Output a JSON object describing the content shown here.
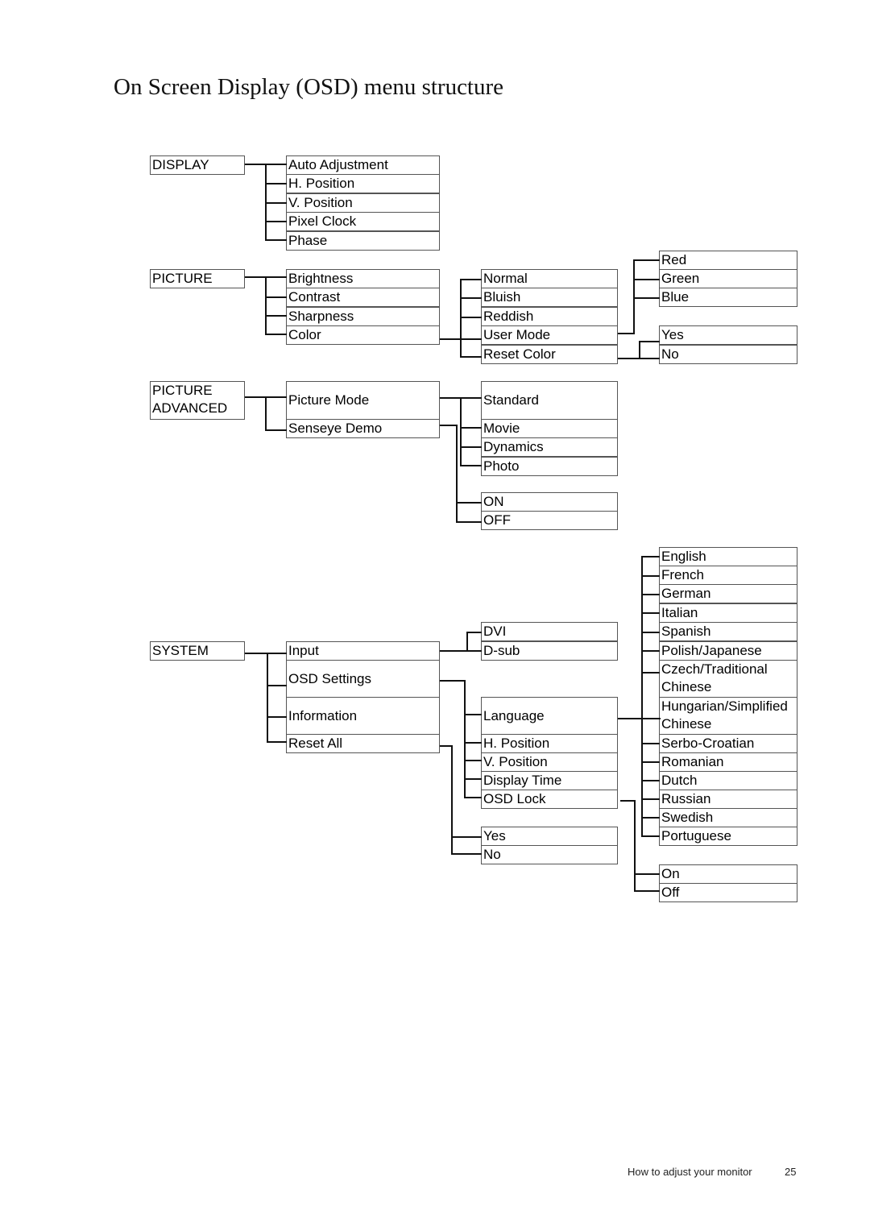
{
  "title": "On Screen Display (OSD) menu structure",
  "menus": {
    "display": {
      "label": "DISPLAY",
      "items": [
        "Auto Adjustment",
        "H. Position",
        "V. Position",
        "Pixel Clock",
        "Phase"
      ]
    },
    "picture": {
      "label": "PICTURE",
      "items": [
        "Brightness",
        "Contrast",
        "Sharpness",
        "Color"
      ],
      "color_options": [
        "Normal",
        "Bluish",
        "Reddish",
        "User Mode",
        "Reset Color"
      ],
      "user_mode_options": [
        "Red",
        "Green",
        "Blue"
      ],
      "reset_color_options": [
        "Yes",
        "No"
      ]
    },
    "picture_advanced": {
      "label_line1": "PICTURE",
      "label_line2": "ADVANCED",
      "items": [
        "Picture Mode",
        "Senseye Demo"
      ],
      "picture_mode_options": [
        "Standard",
        "Movie",
        "Dynamics",
        "Photo"
      ],
      "senseye_demo_options": [
        "ON",
        "OFF"
      ]
    },
    "system": {
      "label": "SYSTEM",
      "items": [
        "Input",
        "OSD Settings",
        "Information",
        "Reset All"
      ],
      "input_options": [
        "DVI",
        "D-sub"
      ],
      "osd_settings_options": [
        "Language",
        "H. Position",
        "V. Position",
        "Display Time",
        "OSD Lock"
      ],
      "reset_all_options": [
        "Yes",
        "No"
      ],
      "language_options": [
        "English",
        "French",
        "German",
        "Italian",
        "Spanish",
        "Polish/Japanese",
        "Czech/Traditional Chinese",
        "Hungarian/Simplified Chinese",
        "Serbo-Croatian",
        "Romanian",
        "Dutch",
        "Russian",
        "Swedish",
        "Portuguese"
      ],
      "osd_lock_options": [
        "On",
        "Off"
      ]
    }
  },
  "footer": {
    "section": "How to adjust your monitor",
    "page_number": "25"
  }
}
